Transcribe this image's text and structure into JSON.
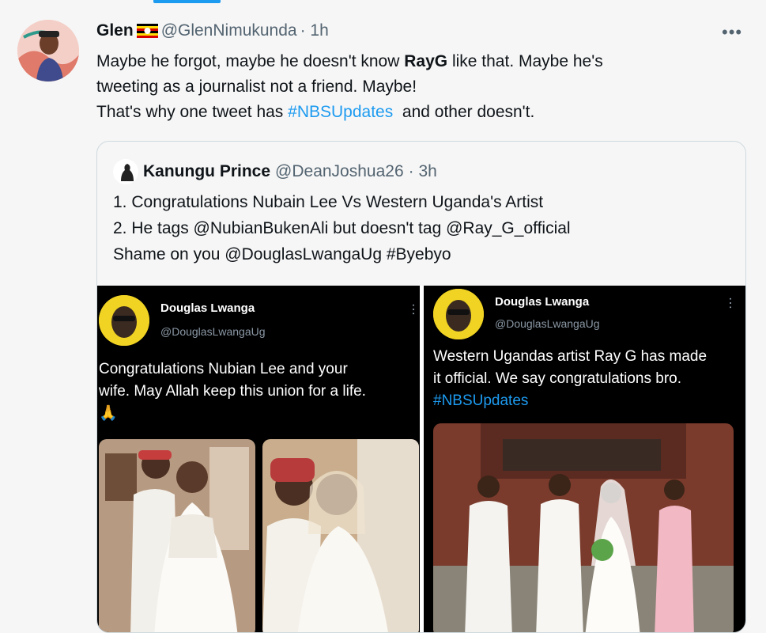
{
  "tweet": {
    "author_name": "Glen",
    "handle": "@GlenNimukunda",
    "time": "· 1h",
    "more_label": "•••",
    "text_l1_a": "Maybe he forgot, maybe he doesn't know ",
    "text_l1_bold": "RayG",
    "text_l1_b": " like that. Maybe he's",
    "text_l2": "tweeting as a journalist not a friend. Maybe!",
    "text_l3_a": "That's why one tweet has ",
    "text_l3_hashtag": "#NBSUpdates",
    "text_l3_b": "  and other doesn't."
  },
  "quote": {
    "author_name": "Kanungu Prince",
    "handle": "@DeanJoshua26",
    "time": "· 3h",
    "line1": "1. Congratulations Nubain Lee Vs Western Uganda's Artist",
    "line2": "2. He tags @NubianBukenAli but doesn't tag @Ray_G_official",
    "line3": "Shame on you @DouglasLwangaUg #Byebyo"
  },
  "media": {
    "left": {
      "name": "Douglas Lwanga",
      "handle": "@DouglasLwangaUg",
      "more": "⋯",
      "line1": "Congratulations Nubian Lee and your",
      "line2": "wife. May Allah keep this union for a life.",
      "line3": "🙏"
    },
    "right": {
      "name": "Douglas Lwanga",
      "handle": "@DouglasLwangaUg",
      "more": "⋯",
      "line1": "Western Ugandas artist Ray G has made",
      "line2": "it official. We say congratulations bro.",
      "hashtag": "#NBSUpdates"
    }
  },
  "colors": {
    "accent": "#1d9bf0",
    "background": "#f6f6f6",
    "text": "#0f1419",
    "muted": "#536471"
  }
}
